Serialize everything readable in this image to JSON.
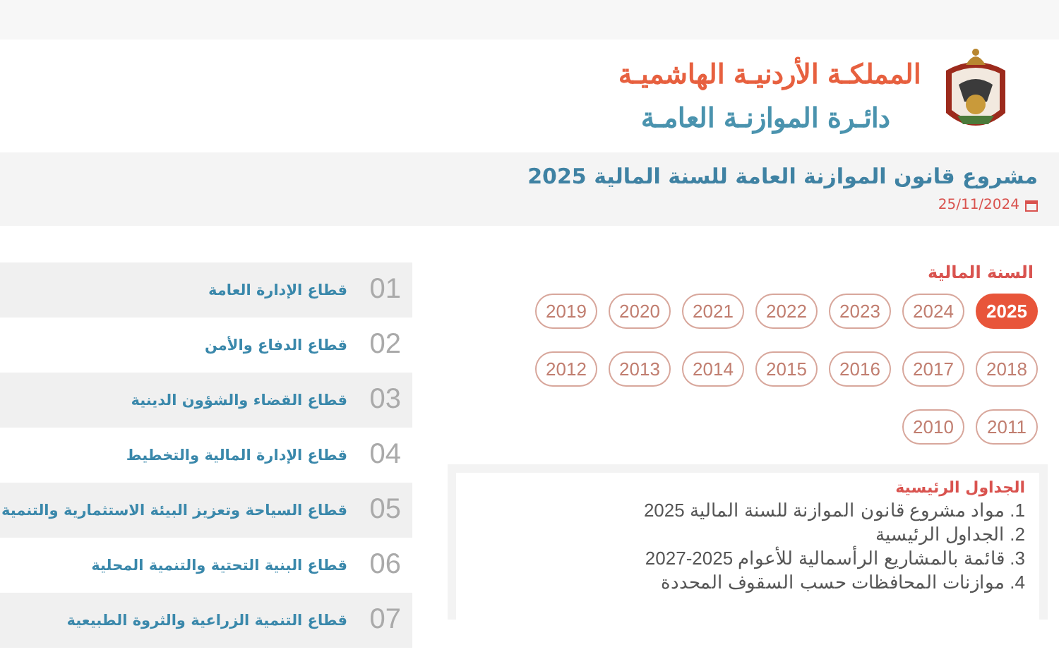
{
  "header": {
    "kingdom": "المملكـة الأردنيـة الهاشميـة",
    "department": "دائـرة الموازنـة العامـة"
  },
  "page": {
    "title": "مشروع قانون الموازنة العامة للسنة المالية 2025",
    "date": "25/11/2024"
  },
  "years": {
    "label": "السنة المالية",
    "items": [
      {
        "label": "2025",
        "selected": true
      },
      {
        "label": "2024",
        "selected": false
      },
      {
        "label": "2023",
        "selected": false
      },
      {
        "label": "2022",
        "selected": false
      },
      {
        "label": "2021",
        "selected": false
      },
      {
        "label": "2020",
        "selected": false
      },
      {
        "label": "2019",
        "selected": false
      },
      {
        "label": "2018",
        "selected": false
      },
      {
        "label": "2017",
        "selected": false
      },
      {
        "label": "2016",
        "selected": false
      },
      {
        "label": "2015",
        "selected": false
      },
      {
        "label": "2014",
        "selected": false
      },
      {
        "label": "2013",
        "selected": false
      },
      {
        "label": "2012",
        "selected": false
      },
      {
        "label": "2011",
        "selected": false
      },
      {
        "label": "2010",
        "selected": false
      }
    ]
  },
  "tables": {
    "title": "الجداول الرئيسية",
    "items": [
      "1. مواد مشروع قانون الموازنة للسنة المالية 2025",
      "2. الجداول الرئيسية",
      "3. قائمة بالمشاريع الرأسمالية للأعوام 2025-2027",
      "4. موازنات المحافظات حسب السقوف المحددة"
    ]
  },
  "sectors": [
    {
      "number": "01",
      "label": "قطاع الإدارة العامة"
    },
    {
      "number": "02",
      "label": "قطاع الدفاع والأمن"
    },
    {
      "number": "03",
      "label": "قطاع القضاء والشؤون الدينية"
    },
    {
      "number": "04",
      "label": "قطاع الإدارة المالية والتخطيط"
    },
    {
      "number": "05",
      "label": "قطاع السياحة وتعزيز البيئة الاستثمارية والتنمية"
    },
    {
      "number": "06",
      "label": "قطاع البنية التحتية والتنمية المحلية"
    },
    {
      "number": "07",
      "label": "قطاع التنمية الزراعية والثروة الطبيعية"
    }
  ]
}
